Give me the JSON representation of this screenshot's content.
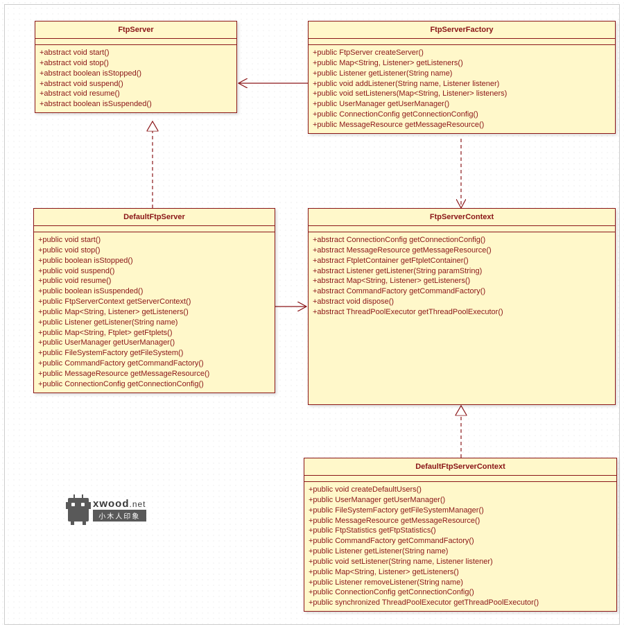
{
  "classes": {
    "ftpServer": {
      "name": "FtpServer",
      "methods": [
        "+abstract void start()",
        "+abstract void stop()",
        "+abstract boolean isStopped()",
        "+abstract void suspend()",
        "+abstract void resume()",
        "+abstract boolean isSuspended()"
      ]
    },
    "ftpServerFactory": {
      "name": "FtpServerFactory",
      "methods": [
        "+public FtpServer createServer()",
        "+public Map<String, Listener> getListeners()",
        "+public Listener getListener(String name)",
        "+public void addListener(String name, Listener listener)",
        "+public void setListeners(Map<String, Listener> listeners)",
        "+public UserManager getUserManager()",
        "+public ConnectionConfig getConnectionConfig()",
        "+public MessageResource getMessageResource()"
      ]
    },
    "defaultFtpServer": {
      "name": "DefaultFtpServer",
      "methods": [
        "+public void start()",
        "+public void stop()",
        "+public boolean isStopped()",
        "+public void suspend()",
        "+public void resume()",
        "+public boolean isSuspended()",
        "+public FtpServerContext getServerContext()",
        "+public Map<String, Listener> getListeners()",
        "+public Listener getListener(String name)",
        "+public Map<String, Ftplet> getFtplets()",
        "+public UserManager getUserManager()",
        "+public FileSystemFactory getFileSystem()",
        "+public CommandFactory getCommandFactory()",
        "+public MessageResource getMessageResource()",
        "+public ConnectionConfig getConnectionConfig()"
      ]
    },
    "ftpServerContext": {
      "name": "FtpServerContext",
      "methods": [
        "+abstract ConnectionConfig getConnectionConfig()",
        "+abstract MessageResource getMessageResource()",
        "+abstract FtpletContainer getFtpletContainer()",
        "+abstract Listener getListener(String paramString)",
        "+abstract Map<String, Listener> getListeners()",
        "+abstract CommandFactory getCommandFactory()",
        "+abstract void dispose()",
        "+abstract ThreadPoolExecutor getThreadPoolExecutor()"
      ]
    },
    "defaultFtpServerContext": {
      "name": "DefaultFtpServerContext",
      "methods": [
        "+public void createDefaultUsers()",
        "+public UserManager getUserManager()",
        "+public FileSystemFactory getFileSystemManager()",
        "+public MessageResource getMessageResource()",
        "+public FtpStatistics getFtpStatistics()",
        "+public CommandFactory getCommandFactory()",
        "+public Listener getListener(String name)",
        "+public void setListener(String name, Listener listener)",
        "+public Map<String, Listener> getListeners()",
        "+public Listener removeListener(String name)",
        "+public ConnectionConfig getConnectionConfig()",
        "+public synchronized ThreadPoolExecutor getThreadPoolExecutor()"
      ]
    }
  },
  "watermark": {
    "line1a": "xwood",
    "line1b": ".net",
    "line2": "小木人印象"
  }
}
